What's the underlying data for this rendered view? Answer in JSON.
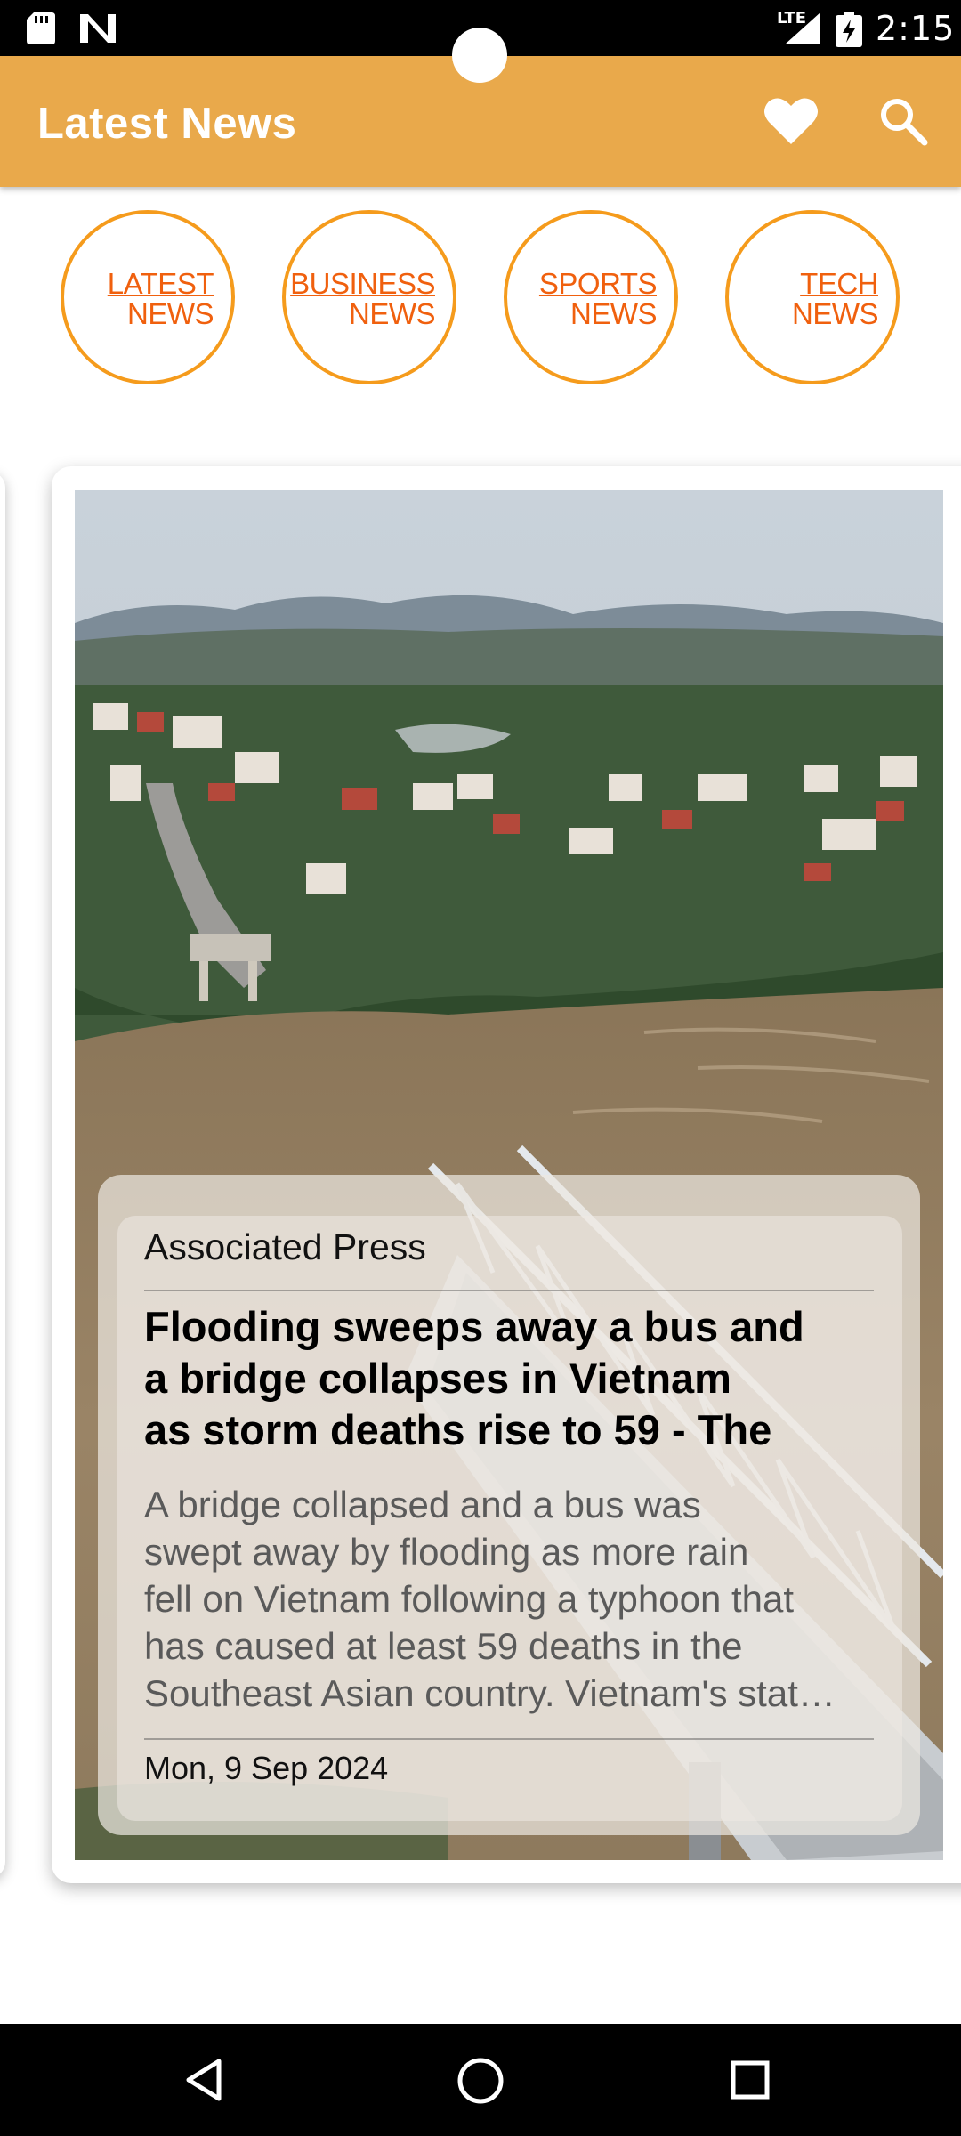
{
  "status_bar": {
    "network": "LTE",
    "time": "2:15",
    "icons": [
      "sd-card-icon",
      "n-logo-icon",
      "signal-icon",
      "battery-charging-icon"
    ]
  },
  "app_bar": {
    "title": "Latest News",
    "actions": [
      "heart-icon",
      "search-icon"
    ],
    "color": "#e9a94b"
  },
  "categories": [
    {
      "line1": "LATEST",
      "line2": "NEWS"
    },
    {
      "line1": "BUSINESS",
      "line2": "NEWS"
    },
    {
      "line1": "SPORTS",
      "line2": "NEWS"
    },
    {
      "line1": "TECH",
      "line2": "NEWS"
    }
  ],
  "category_colors": {
    "ring": "#f59b1c",
    "text": "#f0600e"
  },
  "article": {
    "source": "Associated Press",
    "title_lines": [
      "Flooding sweeps away a bus and",
      "a bridge collapses in Vietnam",
      "as storm deaths rise to 59 - The"
    ],
    "description_lines": [
      "A bridge collapsed and a bus was",
      "swept away by flooding as more rain",
      "fell on Vietnam following a typhoon that",
      "has caused at least 59 deaths in the",
      "Southeast Asian country. Vietnam's stat…"
    ],
    "date": "Mon, 9 Sep 2024"
  },
  "nav_bar": {
    "icons": [
      "back-icon",
      "home-icon",
      "recents-icon"
    ]
  }
}
